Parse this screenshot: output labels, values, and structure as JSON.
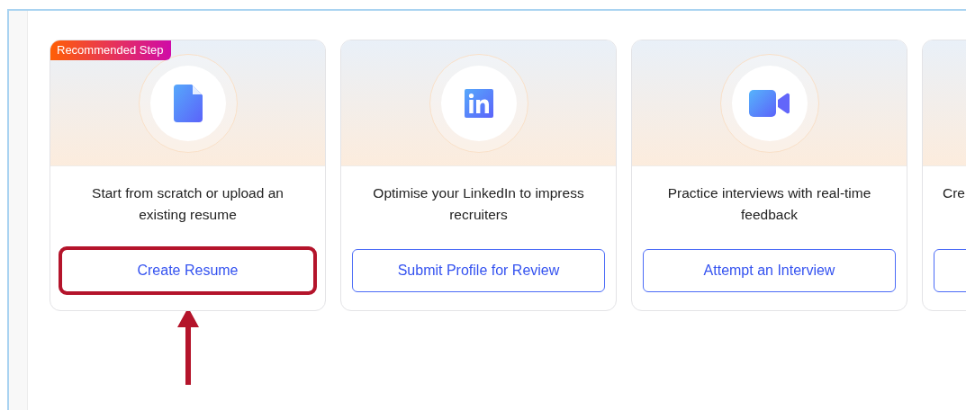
{
  "cards": [
    {
      "badge": "Recommended Step",
      "kind": "document",
      "description": "Start from scratch or upload an existing resume",
      "button": {
        "label": "Create Resume",
        "highlighted": true
      }
    },
    {
      "kind": "linkedin",
      "description": "Optimise your LinkedIn to impress recruiters",
      "button": {
        "label": "Submit Profile for Review",
        "highlighted": false
      }
    },
    {
      "kind": "video",
      "description": "Practice interviews with real-time feedback",
      "button": {
        "label": "Attempt an Interview",
        "highlighted": false
      }
    },
    {
      "kind": "partial",
      "description": "Cre",
      "button": {
        "highlighted": false
      }
    }
  ]
}
